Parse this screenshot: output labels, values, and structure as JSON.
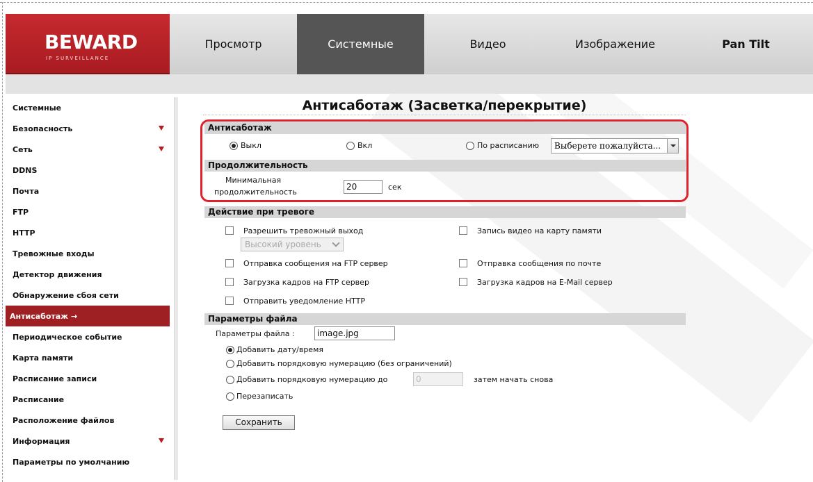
{
  "brand": {
    "name": "BEWARD",
    "tagline": "IP SURVEILLANCE"
  },
  "topnav": {
    "tabs": [
      {
        "label": "Просмотр"
      },
      {
        "label": "Системные",
        "active": true
      },
      {
        "label": "Видео"
      },
      {
        "label": "Изображение"
      },
      {
        "label": "Pan Tilt"
      }
    ]
  },
  "sidebar": {
    "items": [
      {
        "label": "Системные"
      },
      {
        "label": "Безопасность",
        "expandable": true
      },
      {
        "label": "Сеть",
        "expandable": true
      },
      {
        "label": "DDNS"
      },
      {
        "label": "Почта"
      },
      {
        "label": "FTP"
      },
      {
        "label": "HTTP"
      },
      {
        "label": "Тревожные входы"
      },
      {
        "label": "Детектор движения"
      },
      {
        "label": "Обнаружение сбоя сети"
      },
      {
        "label": "Антисаботаж",
        "active": true,
        "arrow": "→"
      },
      {
        "label": "Периодическое событие"
      },
      {
        "label": "Карта памяти"
      },
      {
        "label": "Расписание записи"
      },
      {
        "label": "Расписание"
      },
      {
        "label": "Расположение файлов"
      },
      {
        "label": "Информация",
        "expandable": true
      },
      {
        "label": "Параметры по умолчанию"
      }
    ]
  },
  "main": {
    "title": "Антисаботаж (Засветка/перекрытие)",
    "antisabotage": {
      "header": "Антисаботаж",
      "options": [
        "Выкл",
        "Вкл",
        "По расписанию"
      ],
      "selected": "Выкл",
      "schedule_select": "Выберете пожалуйста..."
    },
    "duration": {
      "header": "Продолжительность",
      "label_line1": "Минимальная",
      "label_line2": "продолжительность",
      "value": "20",
      "unit": "сек"
    },
    "actions": {
      "header": "Действие при тревоге",
      "alarm_output": "Разрешить тревожный выход",
      "alarm_level": "Высокий уровень",
      "sd_record": "Запись видео на карту памяти",
      "ftp_message": "Отправка сообщения на FTP сервер",
      "mail_message": "Отправка сообщения по почте",
      "ftp_upload": "Загрузка кадров на FTP сервер",
      "email_upload": "Загрузка кадров на E-Mail сервер",
      "http_notify": "Отправить уведомление HTTP"
    },
    "file": {
      "header": "Параметры файла",
      "name_label": "Параметры файла :",
      "name_value": "image.jpg",
      "options": [
        "Добавить дату/время",
        "Добавить порядковую нумерацию (без ограничений)",
        "Добавить порядковую нумерацию до",
        "Перезаписать"
      ],
      "selected": "Добавить дату/время",
      "limit_value": "0",
      "limit_suffix": "затем начать снова"
    },
    "save_label": "Сохранить"
  },
  "colors": {
    "brand_red": "#b51f25",
    "active_tab": "#555555",
    "highlight": "#e0212b"
  }
}
